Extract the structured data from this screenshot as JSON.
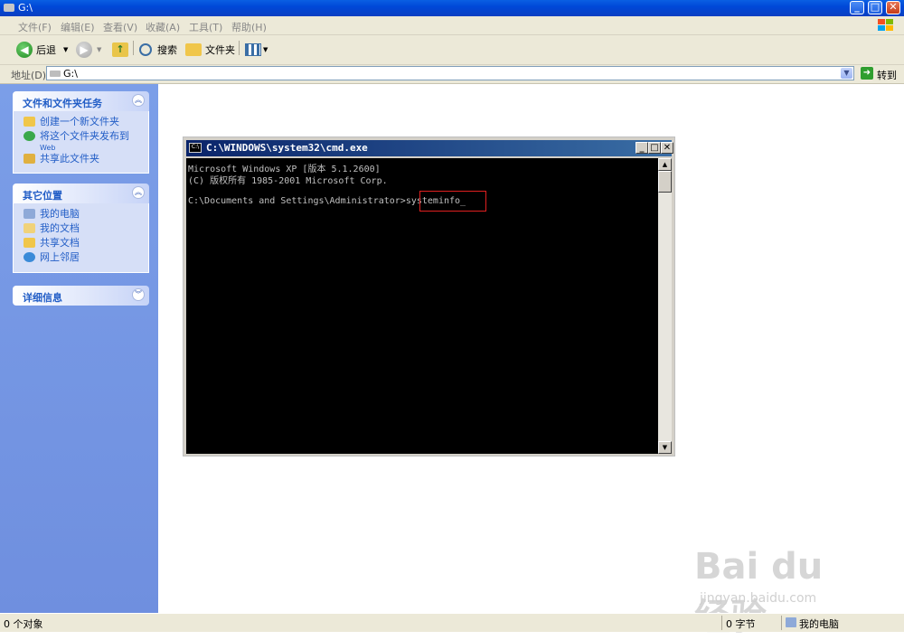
{
  "window": {
    "title": "G:\\"
  },
  "menu": [
    "文件(F)",
    "编辑(E)",
    "查看(V)",
    "收藏(A)",
    "工具(T)",
    "帮助(H)"
  ],
  "toolbar": {
    "back": "后退",
    "search": "搜索",
    "folders": "文件夹"
  },
  "address": {
    "label": "地址(D)",
    "value": "G:\\",
    "go": "转到"
  },
  "taskpane": {
    "file_tasks": {
      "title": "文件和文件夹任务",
      "items": [
        "创建一个新文件夹",
        "将这个文件夹发布到",
        "Web",
        "共享此文件夹"
      ]
    },
    "other_places": {
      "title": "其它位置",
      "items": [
        "我的电脑",
        "我的文档",
        "共享文档",
        "网上邻居"
      ]
    },
    "details": {
      "title": "详细信息"
    }
  },
  "cmd": {
    "title": "C:\\WINDOWS\\system32\\cmd.exe",
    "icon_label": "C:\\",
    "lines": [
      "Microsoft Windows XP [版本 5.1.2600]",
      "(C) 版权所有 1985-2001 Microsoft Corp.",
      "",
      "C:\\Documents and Settings\\Administrator>systeminfo_"
    ]
  },
  "status": {
    "objects": "0 个对象",
    "size": "0 字节",
    "location": "我的电脑"
  },
  "watermark": {
    "brand": "Bai du 经验",
    "url": "jingyan.baidu.com"
  },
  "colors": {
    "titlebar": "#0048d8",
    "taskpane": "#7b9ee8",
    "link": "#215dc6",
    "console_bg": "#000000",
    "highlight": "#e02020"
  }
}
